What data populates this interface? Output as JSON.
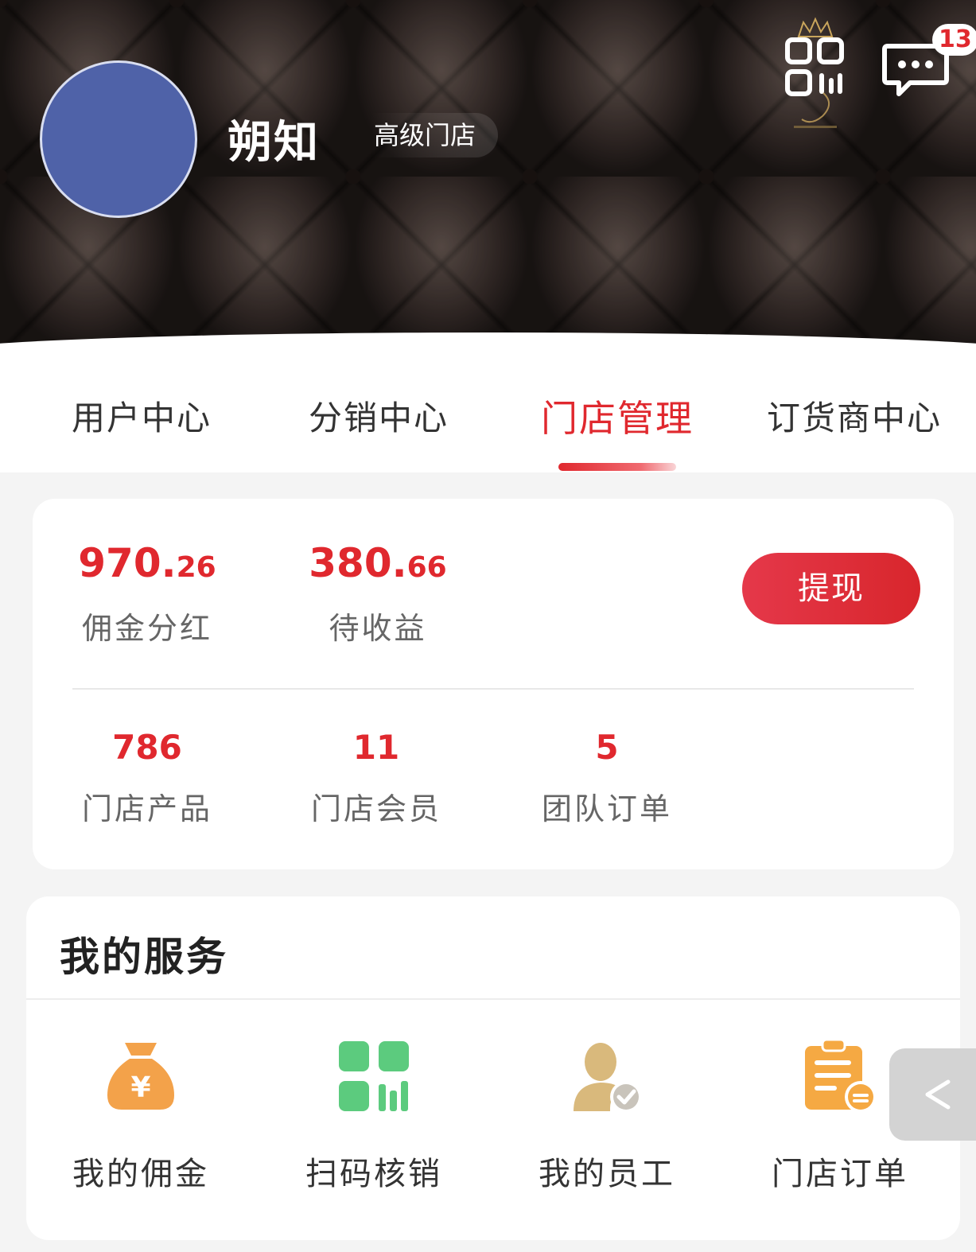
{
  "profile": {
    "name": "朔知",
    "level": "高级门店"
  },
  "header": {
    "message_count": "13"
  },
  "tabs": [
    {
      "label": "用户中心",
      "active": false
    },
    {
      "label": "分销中心",
      "active": false
    },
    {
      "label": "门店管理",
      "active": true
    },
    {
      "label": "订货商中心",
      "active": false
    }
  ],
  "earnings": {
    "commission": {
      "int": "970.",
      "dec": "26",
      "label": "佣金分红"
    },
    "pending": {
      "int": "380.",
      "dec": "66",
      "label": "待收益"
    },
    "withdraw_label": "提现"
  },
  "counts": {
    "products": {
      "value": "786",
      "label": "门店产品"
    },
    "members": {
      "value": "11",
      "label": "门店会员"
    },
    "team_orders": {
      "value": "5",
      "label": "团队订单"
    }
  },
  "services": {
    "title": "我的服务",
    "items": [
      {
        "label": "我的佣金",
        "icon": "money-bag-icon"
      },
      {
        "label": "扫码核销",
        "icon": "scan-verify-icon"
      },
      {
        "label": "我的员工",
        "icon": "staff-icon"
      },
      {
        "label": "门店订单",
        "icon": "store-order-icon"
      }
    ]
  },
  "colors": {
    "accent": "#e0282e",
    "bag": "#f3a24a",
    "scan": "#5ccb7e",
    "staff": "#d9b97c",
    "order": "#f5a943"
  }
}
